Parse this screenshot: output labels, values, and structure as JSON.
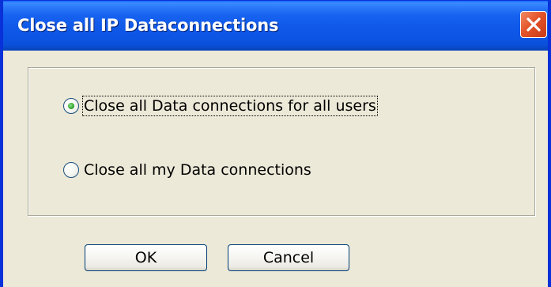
{
  "dialog": {
    "title": "Close all IP Dataconnections"
  },
  "options": [
    {
      "label": "Close all Data connections for all users",
      "selected": true
    },
    {
      "label": "Close all my Data connections",
      "selected": false
    }
  ],
  "buttons": {
    "ok_label": "OK",
    "cancel_label": "Cancel"
  },
  "colors": {
    "title_bar": "#0c55e4",
    "window_border": "#0831d9",
    "dialog_background": "#ece9d8",
    "close_button": "#e3542a",
    "radio_selected_dot": "#2fa52f"
  },
  "icons": {
    "close": "close-x-icon"
  }
}
